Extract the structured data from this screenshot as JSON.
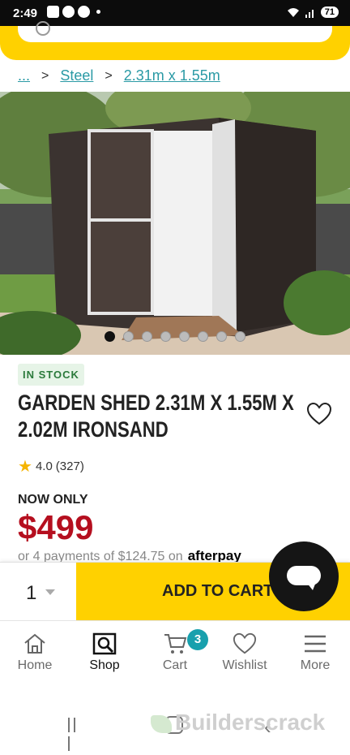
{
  "status_bar": {
    "time": "2:49",
    "battery": "71"
  },
  "breadcrumb": {
    "ellipsis": "...",
    "sep": ">",
    "items": [
      "Steel",
      "2.31m x 1.55m"
    ]
  },
  "product": {
    "stock": "IN STOCK",
    "title": "GARDEN SHED 2.31M X 1.55M X 2.02M IRONSAND",
    "rating": "4.0",
    "reviews": "(327)",
    "now_only": "NOW ONLY",
    "price": "$499",
    "afterpay_text": "or 4 payments of $124.75 on",
    "afterpay_brand": "afterpay",
    "image_count": 8,
    "active_image_index": 0
  },
  "cart": {
    "quantity": "1",
    "add_label": "ADD TO CART"
  },
  "tabs": [
    {
      "label": "Home",
      "icon": "home-icon"
    },
    {
      "label": "Shop",
      "icon": "shop-search-icon"
    },
    {
      "label": "Cart",
      "icon": "cart-icon",
      "badge": "3"
    },
    {
      "label": "Wishlist",
      "icon": "heart-icon"
    },
    {
      "label": "More",
      "icon": "menu-icon"
    }
  ],
  "watermark": "Builderscrack",
  "colors": {
    "brand_yellow": "#FFD100",
    "price_red": "#b50f1f",
    "link_teal": "#2a9aa5",
    "badge_teal": "#18a0ad"
  }
}
